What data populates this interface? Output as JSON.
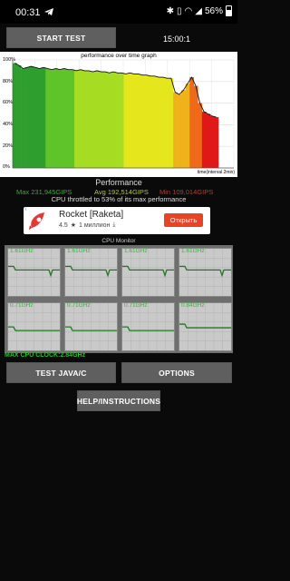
{
  "status_bar": {
    "time": "00:31",
    "battery": "56%",
    "icons": [
      "telegram-icon",
      "bluetooth-icon",
      "vibrate-icon",
      "wifi-icon",
      "signal-icon",
      "battery-icon"
    ]
  },
  "controls": {
    "start_label": "START TEST",
    "timer": "15:00:1"
  },
  "graph": {
    "title": "performance over time graph",
    "y_ticks": [
      "100%",
      "80%",
      "60%",
      "40%",
      "20%",
      "0%"
    ],
    "time_label": "time(interval 2min)"
  },
  "chart_data": {
    "type": "area",
    "title": "performance over time graph",
    "xlabel": "time(interval 2min)",
    "ylabel": "",
    "ylim": [
      0,
      100
    ],
    "values": [
      97,
      95,
      92,
      93,
      94,
      93,
      92,
      93,
      92,
      91,
      92,
      91,
      92,
      91,
      91,
      90,
      91,
      90,
      90,
      89,
      90,
      89,
      89,
      88,
      89,
      88,
      88,
      87,
      88,
      87,
      87,
      86,
      86,
      85,
      85,
      84,
      84,
      83,
      83,
      70,
      68,
      72,
      78,
      84,
      76,
      60,
      52,
      50,
      48,
      47
    ],
    "colors": [
      "#2e9e2e",
      "#5fc42a",
      "#a6dd22",
      "#e6e61c",
      "#f0b21a",
      "#ee6a18",
      "#e01818"
    ]
  },
  "performance": {
    "title": "Performance",
    "max": "Max 231,945GIPS",
    "avg": "Avg 192,514GIPS",
    "min": "Min 109,014GIPS",
    "throttle": "CPU throttled to 53% of its max performance"
  },
  "ad": {
    "ad_label": "i",
    "name": "Rocket [Raketa]",
    "rating": "4.5",
    "downloads": "1 миллион",
    "button": "Открыть"
  },
  "cpu_monitor": {
    "title": "CPU Monitor",
    "cores": [
      {
        "freq": "1.61GHz",
        "load": 0.55
      },
      {
        "freq": "1.61GHz",
        "load": 0.55
      },
      {
        "freq": "1.61GHz",
        "load": 0.55
      },
      {
        "freq": "1.61GHz",
        "load": 0.55
      },
      {
        "freq": "0.71GHz",
        "load": 0.42
      },
      {
        "freq": "0.71GHz",
        "load": 0.42
      },
      {
        "freq": "0.71GHz",
        "load": 0.42
      },
      {
        "freq": "0.84GHz",
        "load": 0.48
      }
    ],
    "max_clock": "MAX CPU CLOCK:2.84GHz"
  },
  "buttons": {
    "java": "TEST JAVA/C",
    "options": "OPTIONS",
    "help": "HELP/INSTRUCTIONS"
  }
}
